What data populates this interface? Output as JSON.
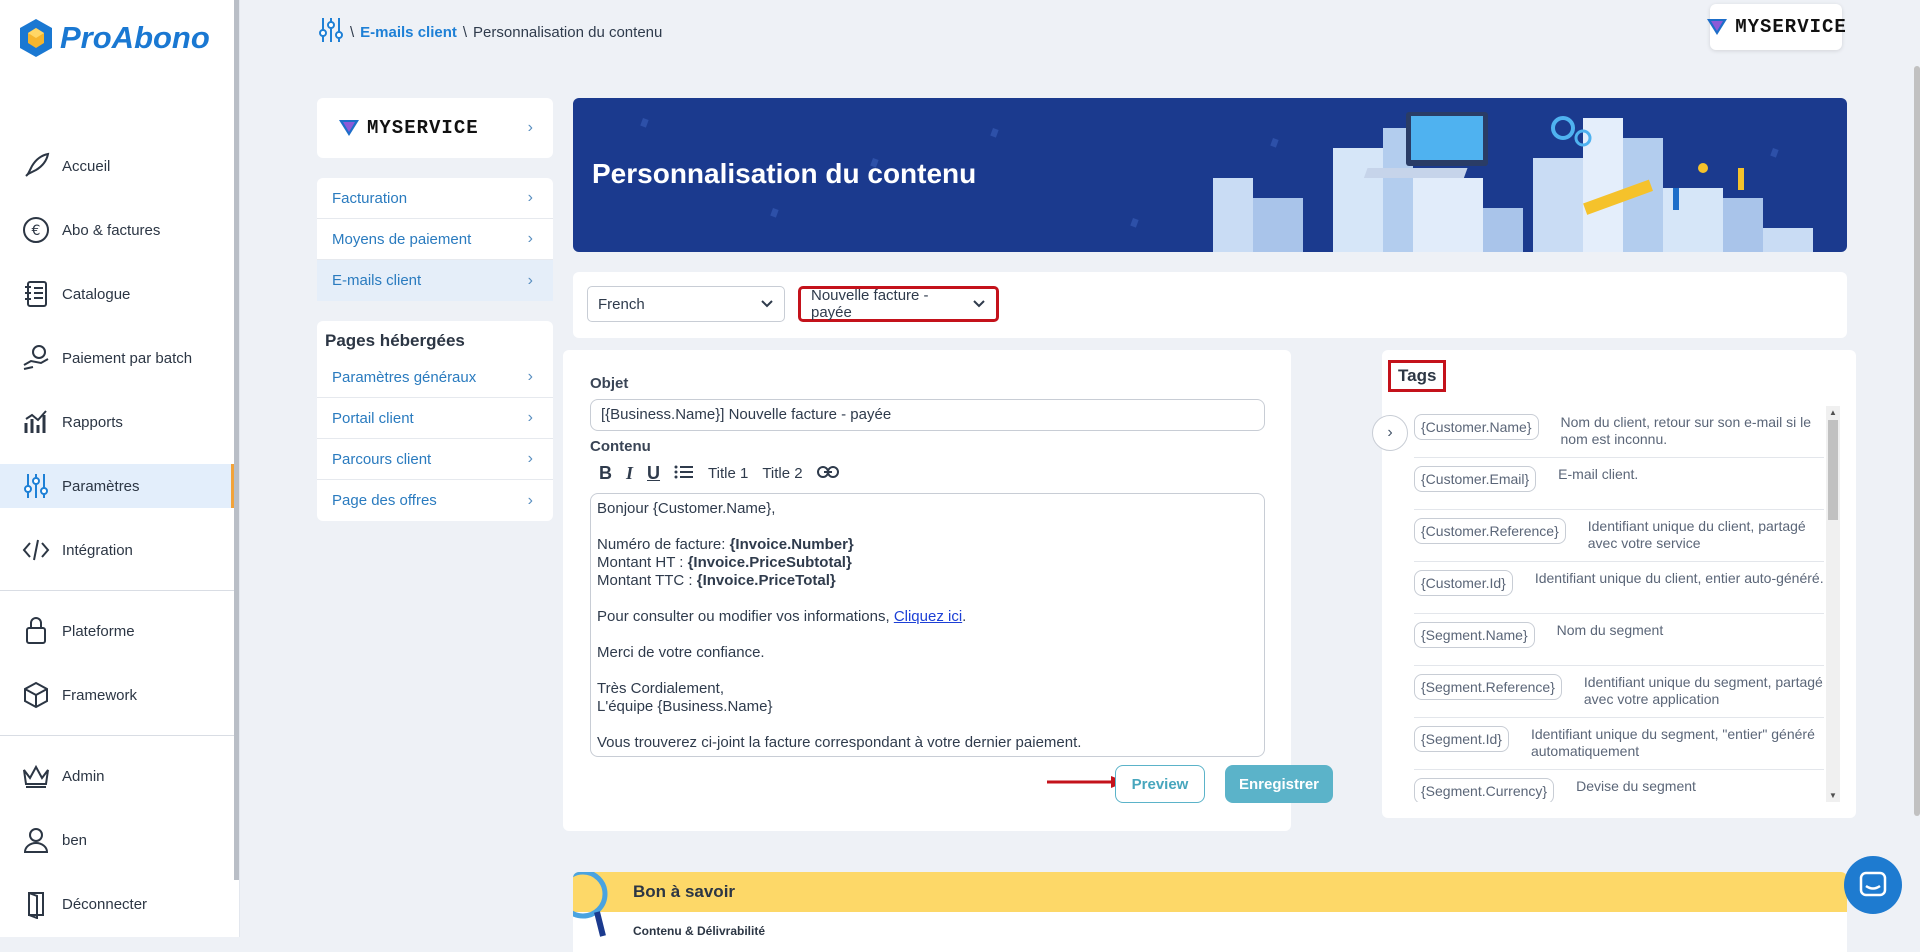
{
  "app": {
    "logo_text": "ProAbono",
    "brand": "MYSERVICE"
  },
  "sidebar": {
    "items": [
      {
        "label": "Accueil",
        "icon": "rocket-icon"
      },
      {
        "label": "Abo & factures",
        "icon": "euro-icon"
      },
      {
        "label": "Catalogue",
        "icon": "notebook-icon"
      },
      {
        "label": "Paiement par batch",
        "icon": "hand-coin-icon"
      },
      {
        "label": "Rapports",
        "icon": "chart-icon"
      },
      {
        "label": "Paramètres",
        "icon": "sliders-icon"
      },
      {
        "label": "Intégration",
        "icon": "code-icon"
      },
      {
        "label": "Plateforme",
        "icon": "lock-icon"
      },
      {
        "label": "Framework",
        "icon": "cube-icon"
      },
      {
        "label": "Admin",
        "icon": "crown-icon"
      },
      {
        "label": "ben",
        "icon": "user-icon"
      },
      {
        "label": "Déconnecter",
        "icon": "door-icon"
      }
    ]
  },
  "breadcrumb": {
    "sep": "\\",
    "link": "E-mails client",
    "current": "Personnalisation du contenu"
  },
  "left_menu": {
    "brand": "MYSERVICE",
    "group1": [
      "Facturation",
      "Moyens de paiement",
      "E-mails client"
    ],
    "section_title": "Pages hébergées",
    "group2": [
      "Paramètres généraux",
      "Portail client",
      "Parcours client",
      "Page des offres"
    ]
  },
  "banner": {
    "title": "Personnalisation du contenu"
  },
  "selectors": {
    "language": "French",
    "template": "Nouvelle facture - payée"
  },
  "editor": {
    "subject_label": "Objet",
    "subject_value": "[{Business.Name}] Nouvelle facture - payée",
    "content_label": "Contenu",
    "toolbar": {
      "bold": "B",
      "italic": "I",
      "underline": "U",
      "title1": "Title 1",
      "title2": "Title 2"
    },
    "body": {
      "greeting": "Bonjour {Customer.Name},",
      "inv_label": "Numéro de facture: ",
      "inv_value": "{Invoice.Number}",
      "ht_label": "Montant HT : ",
      "ht_value": "{Invoice.PriceSubtotal}",
      "ttc_label": "Montant TTC : ",
      "ttc_value": "{Invoice.PriceTotal}",
      "consult": "Pour consulter ou modifier vos informations, ",
      "link": "Cliquez ici",
      "dot": ".",
      "thanks": "Merci de votre confiance.",
      "regards": "Très Cordialement,",
      "team": "L'équipe {Business.Name}",
      "footer": "Vous trouverez ci-joint la facture correspondant à votre dernier paiement."
    },
    "preview_label": "Preview",
    "save_label": "Enregistrer"
  },
  "tags": {
    "title": "Tags",
    "rows": [
      {
        "tag": "{Customer.Name}",
        "desc": "Nom du client, retour sur son e-mail si le nom est inconnu."
      },
      {
        "tag": "{Customer.Email}",
        "desc": "E-mail client."
      },
      {
        "tag": "{Customer.Reference}",
        "desc": "Identifiant unique du client, partagé avec votre service"
      },
      {
        "tag": "{Customer.Id}",
        "desc": "Identifiant unique du client, entier auto-généré."
      },
      {
        "tag": "{Segment.Name}",
        "desc": "Nom du segment"
      },
      {
        "tag": "{Segment.Reference}",
        "desc": "Identifiant unique du segment, partagé avec votre application"
      },
      {
        "tag": "{Segment.Id}",
        "desc": "Identifiant unique du segment, \"entier\" généré automatiquement"
      },
      {
        "tag": "{Segment.Currency}",
        "desc": "Devise du segment"
      }
    ]
  },
  "info": {
    "title": "Bon à savoir",
    "subtitle": "Contenu & Délivrabilité"
  },
  "colors": {
    "primary": "#1e80d6",
    "highlight": "#c4121b",
    "accent": "#f2a33a",
    "teal": "#5bb3c9",
    "banner": "#1b3a8e"
  }
}
